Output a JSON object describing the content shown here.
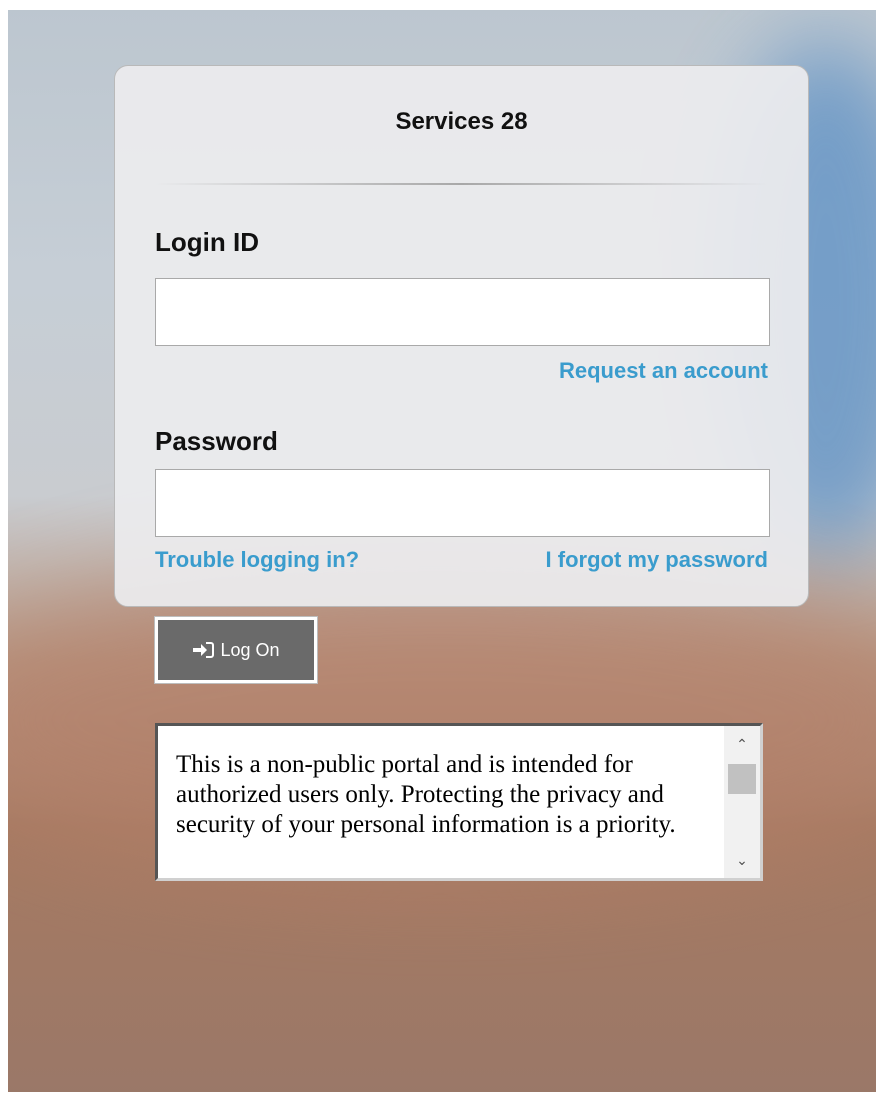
{
  "card": {
    "title": "Services 28"
  },
  "login_id": {
    "label": "Login ID",
    "value": "",
    "placeholder": ""
  },
  "request_account_link": "Request an account",
  "password": {
    "label": "Password",
    "value": "",
    "placeholder": ""
  },
  "trouble_link": "Trouble logging in?",
  "forgot_link": "I forgot my password",
  "logon_button": {
    "label": "Log On",
    "icon": "sign-in-icon"
  },
  "notice": {
    "text": "This is a non-public portal and is intended for authorized users only. Protecting the privacy and security of your personal information is a priority."
  },
  "colors": {
    "link": "#3a9ccd",
    "button_bg": "#6a6a6a"
  }
}
